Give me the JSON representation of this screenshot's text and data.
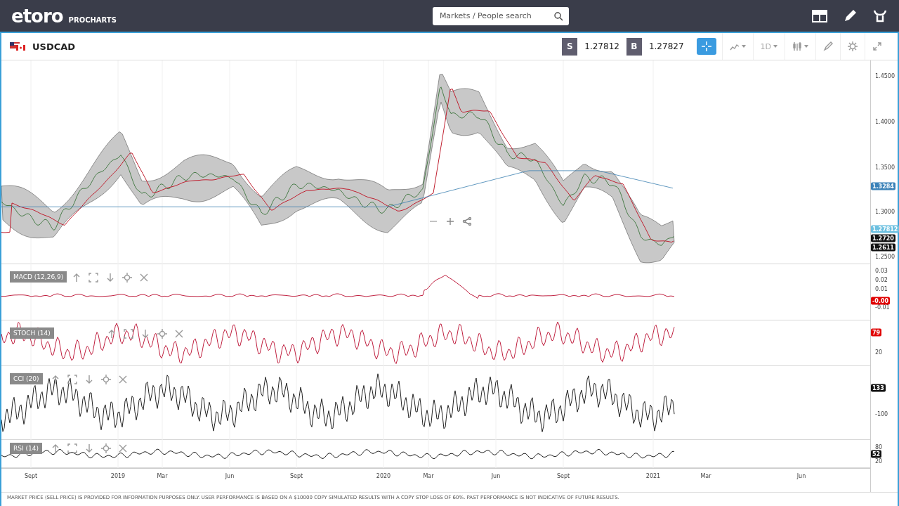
{
  "header": {
    "logo": "etoro",
    "logo_sub": "PROCHARTS",
    "search": {
      "placeholder": "Markets / People search"
    }
  },
  "instrument": {
    "symbol": "USDCAD",
    "sell_label": "S",
    "sell_price": "1.27812",
    "buy_label": "B",
    "buy_price": "1.27827",
    "crosshair_on": true,
    "timeframe": "1D"
  },
  "price_panel": {
    "axis": [
      "1.4500",
      "1.4000",
      "1.3500",
      "1.3000",
      "1.2500"
    ],
    "badges": [
      {
        "text": "1.3284",
        "color": "#3b82b8"
      },
      {
        "text": "1.27812",
        "color": "#6cc0e0"
      },
      {
        "text": "1.2720",
        "color": "#111111"
      },
      {
        "text": "1.2611",
        "color": "#111111"
      }
    ]
  },
  "indicators": [
    {
      "kind": "macd",
      "label": "MACD (12,26,9)",
      "axis": [
        "0.03",
        "0.02",
        "0.01",
        "-0.01"
      ],
      "badges": [
        {
          "text": "-0.00",
          "color": "#e00000"
        }
      ]
    },
    {
      "kind": "stoch",
      "label": "STOCH (14)",
      "axis": [
        "20"
      ],
      "badges": [
        {
          "text": "79",
          "color": "#e00000"
        }
      ]
    },
    {
      "kind": "cci",
      "label": "CCI (20)",
      "axis": [
        "-100"
      ],
      "badges": [
        {
          "text": "133",
          "color": "#111111"
        }
      ]
    },
    {
      "kind": "rsi",
      "label": "RSI (14)",
      "axis": [
        "80",
        "20"
      ],
      "badges": [
        {
          "text": "52",
          "color": "#111111"
        }
      ]
    }
  ],
  "x_axis": [
    "Sept",
    "2019",
    "Mar",
    "Jun",
    "Sept",
    "2020",
    "Mar",
    "Jun",
    "Sept",
    "2021",
    "Mar",
    "Jun"
  ],
  "disclaimer": "MARKET PRICE (SELL PRICE) IS PROVIDED FOR INFORMATION PURPOSES ONLY. USER PERFORMANCE IS BASED ON A $10000 COPY SIMULATED RESULTS WITH A COPY STOP LOSS OF 60%. PAST PERFORMANCE IS NOT INDICATIVE OF FUTURE RESULTS."
}
